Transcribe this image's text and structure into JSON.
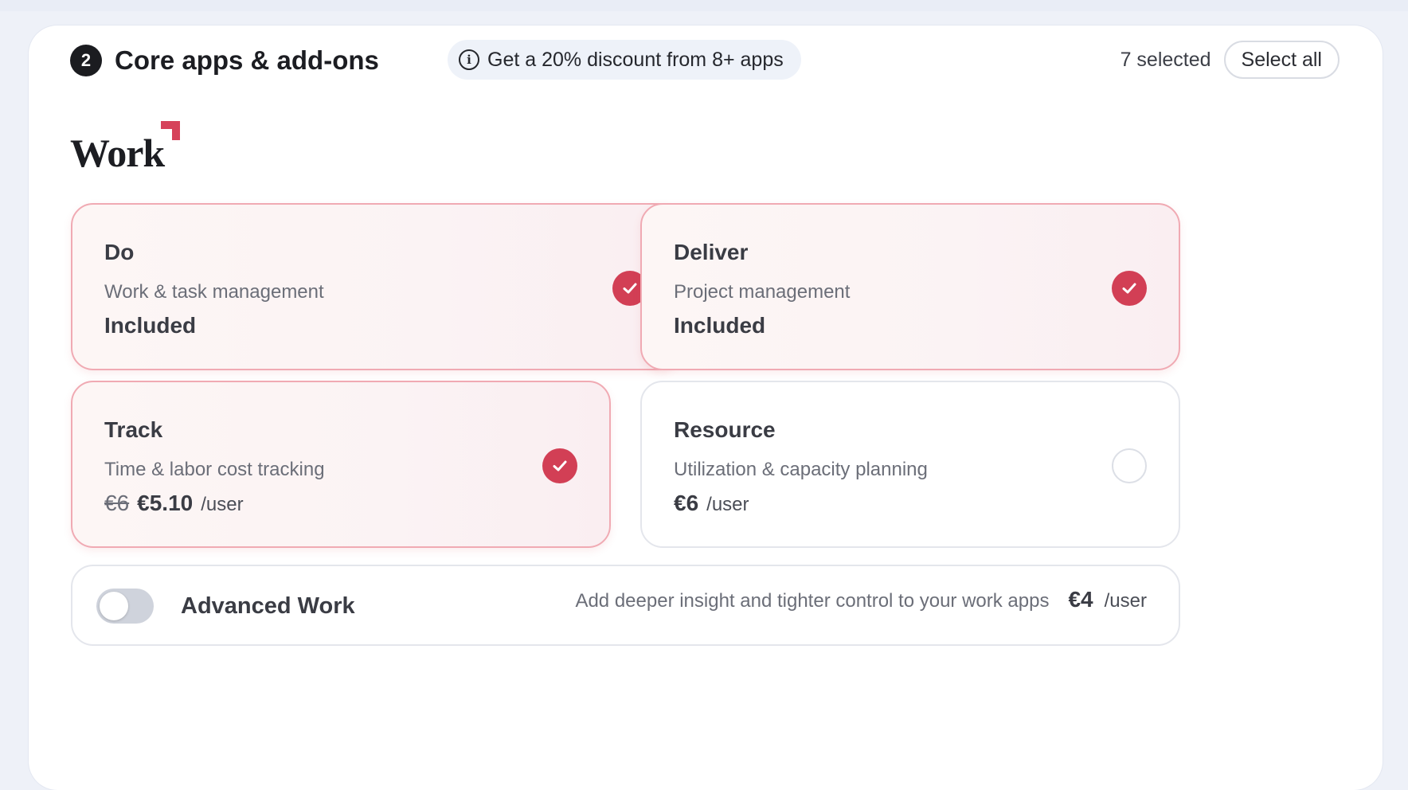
{
  "section": {
    "step_number": "2",
    "title": "Core apps & add-ons",
    "discount_text": "Get a 20% discount from 8+ apps",
    "selected_count": "7 selected",
    "select_all_label": "Select all"
  },
  "logo": {
    "text": "Work"
  },
  "colors": {
    "accent": "#d23f55",
    "logo_mark": "#d6425a"
  },
  "cards": [
    {
      "title": "Do",
      "description": "Work & task management",
      "price": "Included",
      "selected": true
    },
    {
      "title": "Deliver",
      "description": "Project management",
      "price": "Included",
      "selected": true
    },
    {
      "title": "Track",
      "description": "Time & labor cost tracking",
      "old_price": "€6",
      "price": "€5.10",
      "unit": "/user",
      "selected": true
    },
    {
      "title": "Resource",
      "description": "Utilization & capacity planning",
      "price": "€6",
      "unit": "/user",
      "selected": false
    }
  ],
  "addon": {
    "name": "Advanced Work",
    "description": "Add deeper insight and tighter control to your work apps",
    "price": "€4",
    "unit": "/user",
    "enabled": false
  }
}
